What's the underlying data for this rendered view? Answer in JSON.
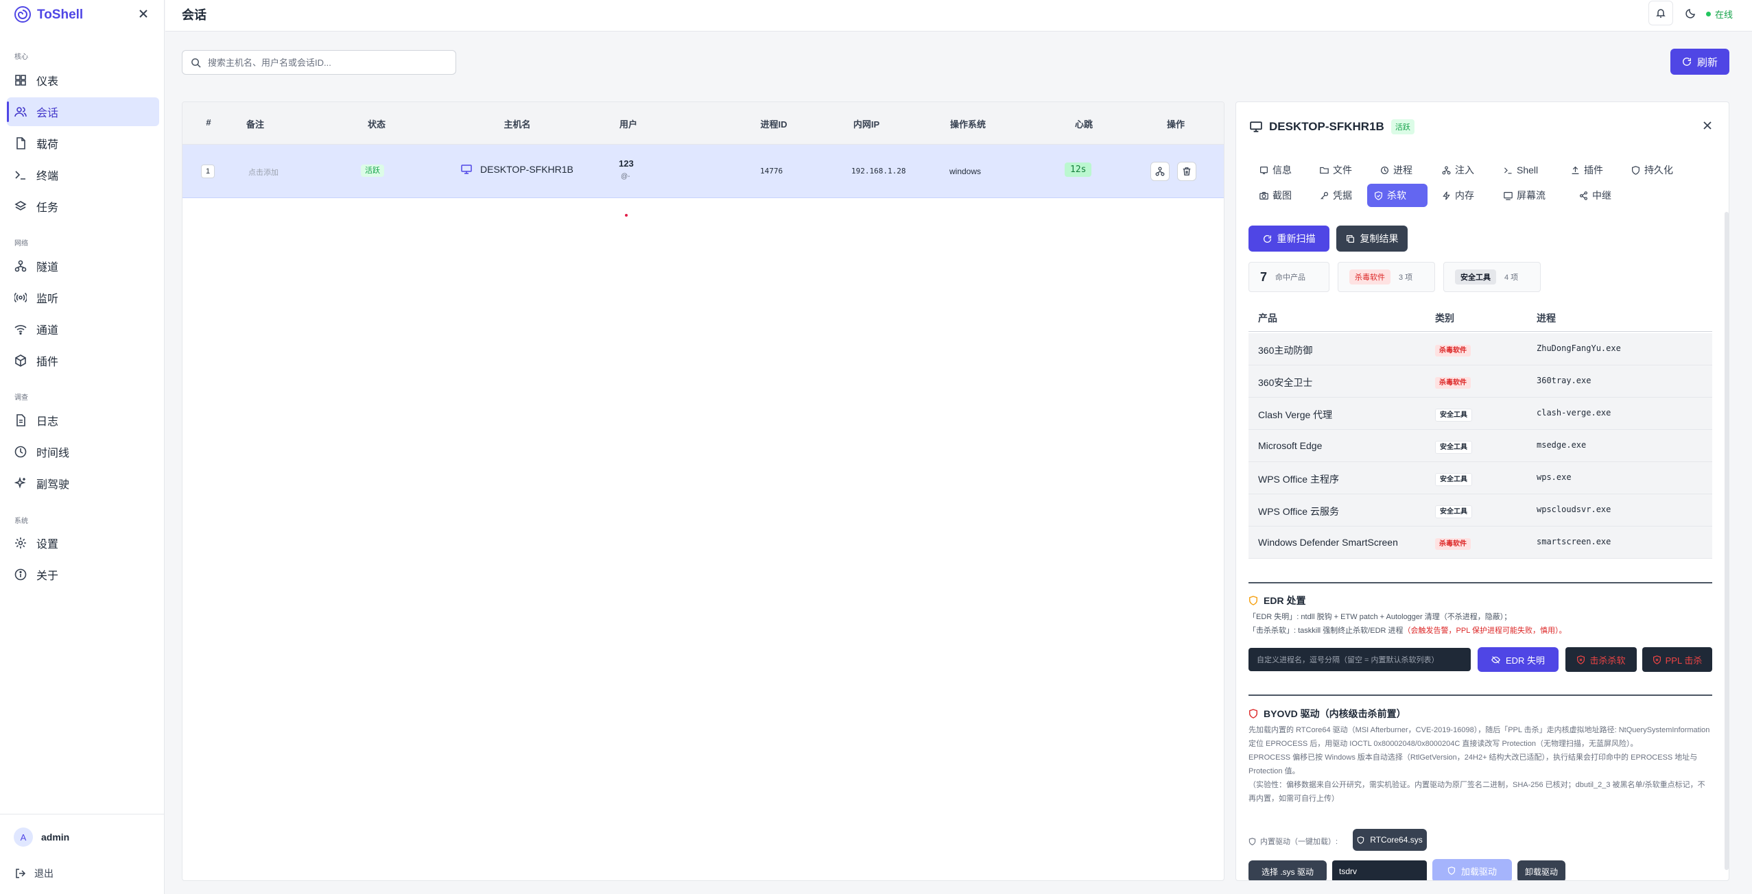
{
  "sidebar": {
    "brand": "ToShell",
    "sections": [
      {
        "label": "核心"
      },
      {
        "label": "网络"
      },
      {
        "label": "调查"
      },
      {
        "label": "系统"
      }
    ],
    "items": [
      {
        "label": "仪表",
        "icon": "dashboard-icon"
      },
      {
        "label": "会话",
        "icon": "users-icon",
        "active": true
      },
      {
        "label": "载荷",
        "icon": "file-icon"
      },
      {
        "label": "终端",
        "icon": "terminal-icon"
      },
      {
        "label": "任务",
        "icon": "layers-icon"
      },
      {
        "label": "隧道",
        "icon": "network-icon"
      },
      {
        "label": "监听",
        "icon": "radio-icon"
      },
      {
        "label": "通道",
        "icon": "wifi-icon"
      },
      {
        "label": "插件",
        "icon": "package-icon"
      },
      {
        "label": "日志",
        "icon": "log-icon"
      },
      {
        "label": "时间线",
        "icon": "clock-icon"
      },
      {
        "label": "副驾驶",
        "icon": "sparkle-icon"
      },
      {
        "label": "设置",
        "icon": "gear-icon"
      },
      {
        "label": "关于",
        "icon": "info-icon"
      }
    ],
    "user": {
      "initial": "A",
      "name": "admin"
    },
    "logout": "退出"
  },
  "header": {
    "title": "会话",
    "status": "在线"
  },
  "toolbar": {
    "search_placeholder": "搜索主机名、用户名或会话ID...",
    "refresh": "刷新"
  },
  "table": {
    "columns": [
      "#",
      "备注",
      "状态",
      "主机名",
      "用户",
      "进程ID",
      "内网IP",
      "操作系统",
      "心跳",
      "操作"
    ],
    "rows": [
      {
        "num": "1",
        "note": "点击添加",
        "status": "活跃",
        "hostname": "DESKTOP-SFKHR1B",
        "user": "123",
        "user_sub": "@-",
        "pid": "14776",
        "ip": "192.168.1.28",
        "os": "windows",
        "heartbeat": "12s"
      }
    ]
  },
  "detail": {
    "hostname": "DESKTOP-SFKHR1B",
    "status": "活跃",
    "tabs_row1": [
      "信息",
      "文件",
      "进程",
      "注入",
      "Shell",
      "插件",
      "持久化"
    ],
    "tabs_row2": [
      "截图",
      "凭据",
      "杀软",
      "内存",
      "屏幕流",
      "中继"
    ],
    "rescan": "重新扫描",
    "copy": "复制结果",
    "stats": {
      "hit_count": "7",
      "hit_label": "命中产品",
      "av_label": "杀毒软件",
      "av_count": "3 项",
      "tool_label": "安全工具",
      "tool_count": "4 项"
    },
    "product_columns": [
      "产品",
      "类别",
      "进程"
    ],
    "products": [
      {
        "name": "360主动防御",
        "category": "杀毒软件",
        "kind": "av",
        "process": "ZhuDongFangYu.exe"
      },
      {
        "name": "360安全卫士",
        "category": "杀毒软件",
        "kind": "av",
        "process": "360tray.exe"
      },
      {
        "name": "Clash Verge 代理",
        "category": "安全工具",
        "kind": "tool",
        "process": "clash-verge.exe"
      },
      {
        "name": "Microsoft Edge",
        "category": "安全工具",
        "kind": "tool",
        "process": "msedge.exe"
      },
      {
        "name": "WPS Office 主程序",
        "category": "安全工具",
        "kind": "tool",
        "process": "wps.exe"
      },
      {
        "name": "WPS Office 云服务",
        "category": "安全工具",
        "kind": "tool",
        "process": "wpscloudsvr.exe"
      },
      {
        "name": "Windows Defender SmartScreen",
        "category": "杀毒软件",
        "kind": "av",
        "process": "smartscreen.exe"
      }
    ],
    "edr": {
      "title": "EDR 处置",
      "line1": "「EDR 失明」: ntdll 脱钩 + ETW patch + Autologger 清理（不杀进程，隐蔽）；",
      "line2_a": "「击杀杀软」: taskkill 强制终止杀软/EDR 进程",
      "line2_b": "（会触发告警，PPL 保护进程可能失败，慎用）。",
      "input_placeholder": "自定义进程名，逗号分隔（留空 = 内置默认杀软列表）",
      "blind_btn": "EDR 失明",
      "kill_btn": "击杀杀软",
      "ppl_btn": "PPL 击杀"
    },
    "byovd": {
      "title": "BYOVD 驱动（内核级击杀前置）",
      "p1": "先加载内置的 RTCore64 驱动（MSI Afterburner，CVE-2019-16098），随后「PPL 击杀」走内核虚拟地址路径: NtQuerySystemInformation 定位 EPROCESS 后，用驱动 IOCTL 0x80002048/0x8000204C 直接读改写 Protection（无物理扫描，无蓝屏风险）。",
      "p2": "EPROCESS 偏移已按 Windows 版本自动选择（RtlGetVersion，24H2+ 结构大改已适配），执行结果会打印命中的 EPROCESS 地址与 Protection 值。",
      "p3": "（实验性：偏移数据来自公开研究，需实机验证。内置驱动为原厂签名二进制，SHA-256 已核对；dbutil_2_3 被黑名单/杀软重点标记，不再内置，如需可自行上传）",
      "builtin_label": "内置驱动（一键加载）:",
      "builtin_driver": "RTCore64.sys",
      "select_btn": "选择 .sys 驱动",
      "driver_name": "tsdrv",
      "load_btn": "加载驱动",
      "unload_btn": "卸载驱动"
    }
  }
}
